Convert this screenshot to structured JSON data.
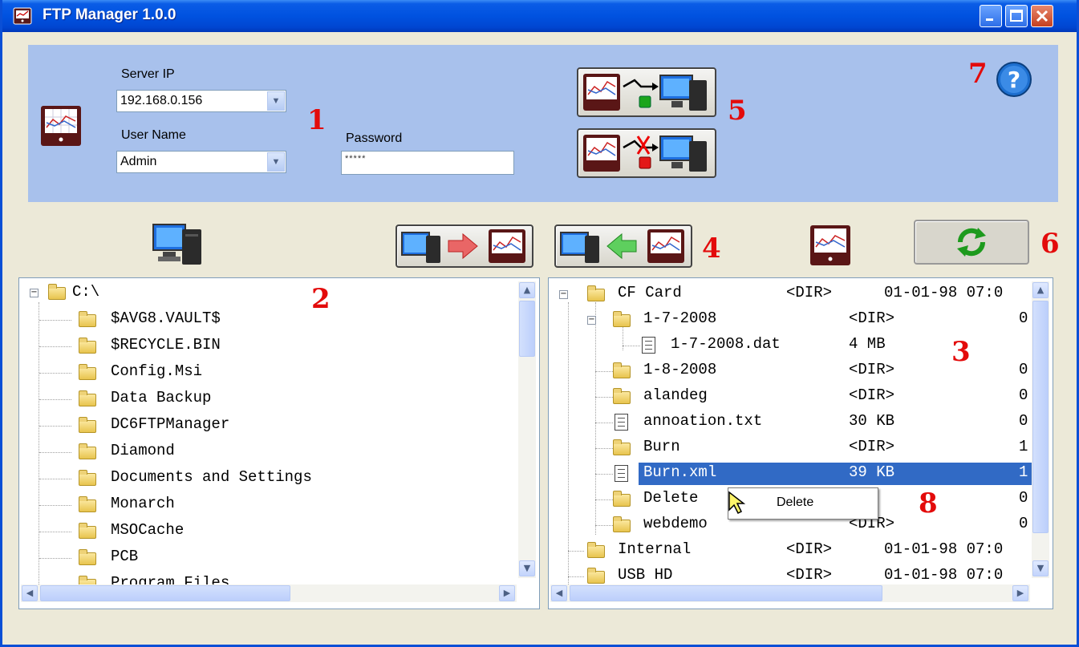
{
  "window": {
    "title": "FTP Manager 1.0.0"
  },
  "connection": {
    "server_ip_label": "Server IP",
    "server_ip_value": "192.168.0.156",
    "user_name_label": "User Name",
    "user_name_value": "Admin",
    "password_label": "Password",
    "password_value": "*****"
  },
  "callouts": [
    "1",
    "2",
    "3",
    "4",
    "5",
    "6",
    "7",
    "8"
  ],
  "local_tree": {
    "root": "C:\\",
    "items": [
      "$AVG8.VAULT$",
      "$RECYCLE.BIN",
      "Config.Msi",
      "Data Backup",
      "DC6FTPManager",
      "Diamond",
      "Documents and Settings",
      "Monarch",
      "MSOCache",
      "PCB",
      "Program Files"
    ]
  },
  "remote_tree": {
    "rows": [
      {
        "name": "CF Card",
        "size": "<DIR>",
        "date": "01-01-98 07:0",
        "type": "folder"
      },
      {
        "name": "1-7-2008",
        "size": "<DIR>",
        "date": "0",
        "type": "folder"
      },
      {
        "name": "1-7-2008.dat",
        "size": "4 MB",
        "date": "",
        "type": "file"
      },
      {
        "name": "1-8-2008",
        "size": "<DIR>",
        "date": "0",
        "type": "folder"
      },
      {
        "name": "alandeg",
        "size": "<DIR>",
        "date": "0",
        "type": "folder"
      },
      {
        "name": "annoation.txt",
        "size": "30 KB",
        "date": "0",
        "type": "file"
      },
      {
        "name": "Burn",
        "size": "<DIR>",
        "date": "1",
        "type": "folder"
      },
      {
        "name": "Burn.xml",
        "size": "39 KB",
        "date": "1",
        "type": "file",
        "selected": true
      },
      {
        "name": "Delete",
        "size": "R>",
        "date": "0",
        "type": "folder"
      },
      {
        "name": "webdemo",
        "size": "<DIR>",
        "date": "0",
        "type": "folder"
      },
      {
        "name": "Internal",
        "size": "<DIR>",
        "date": "01-01-98 07:0",
        "type": "folder"
      },
      {
        "name": "USB HD",
        "size": "<DIR>",
        "date": "01-01-98 07:0",
        "type": "folder"
      }
    ]
  },
  "context_menu": {
    "items": [
      "Delete"
    ]
  },
  "icons": {
    "device": "recorder-device-icon",
    "computer": "computer-icon",
    "connect": "connect-icon",
    "disconnect": "disconnect-icon",
    "upload": "upload-to-device-icon",
    "download": "download-to-computer-icon",
    "refresh": "refresh-icon",
    "help": "help-icon"
  },
  "colors": {
    "title_bar": "#0052e0",
    "header_panel": "#a8c1ec",
    "selection": "#316ac5",
    "callout": "#e30b0b"
  }
}
